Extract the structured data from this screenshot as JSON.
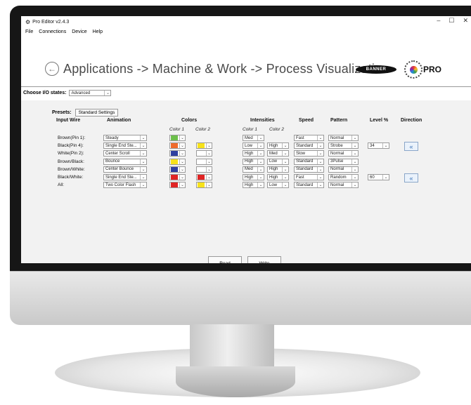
{
  "window": {
    "title": "Pro Editor v2.4.3",
    "controls": [
      "–",
      "☐",
      "✕"
    ]
  },
  "menu": [
    "File",
    "Connections",
    "Device",
    "Help"
  ],
  "breadcrumb": "Applications -> Machine & Work -> Process Visualization",
  "logos": {
    "banner": "BANNER",
    "pro": "PRO"
  },
  "io_states": {
    "label": "Choose I/O states:",
    "value": "Advanced"
  },
  "presets": {
    "label": "Presets:",
    "button": "Standard Settings"
  },
  "headers": {
    "input_wire": "Input Wire",
    "animation": "Animation",
    "colors": "Colors",
    "color1": "Color 1",
    "color2": "Color 2",
    "intensities": "Intensities",
    "int1": "Color 1",
    "int2": "Color 2",
    "speed": "Speed",
    "pattern": "Pattern",
    "level": "Level %",
    "direction": "Direction"
  },
  "rows": [
    {
      "wire": "Brown(Pin 1):",
      "animation": "Steady",
      "color1": "#6cbf4a",
      "color2": null,
      "int1": "Med",
      "int2": null,
      "speed": "Fast",
      "pattern": "Normal",
      "level": null,
      "direction": null
    },
    {
      "wire": "Black(Pin 4):",
      "animation": "Single End Ste...",
      "color1": "#ef6b2c",
      "color2": "#f7e21a",
      "int1": "Low",
      "int2": "High",
      "speed": "Standard",
      "pattern": "Strobe",
      "level": "34",
      "direction": "«"
    },
    {
      "wire": "White(Pin 2):",
      "animation": "Center Scroll",
      "color1": "#2f3fa0",
      "color2": "",
      "int1": "High",
      "int2": "Med",
      "speed": "Slow",
      "pattern": "Normal",
      "level": null,
      "direction": null
    },
    {
      "wire": "Brown/Black:",
      "animation": "Bounce",
      "color1": "#f7e21a",
      "color2": "",
      "int1": "High",
      "int2": "Low",
      "speed": "Standard",
      "pattern": "3Pulse",
      "level": null,
      "direction": null
    },
    {
      "wire": "Brown/White:",
      "animation": "Center Bounce",
      "color1": "#2f3fa0",
      "color2": "",
      "int1": "Med",
      "int2": "High",
      "speed": "Standard",
      "pattern": "Normal",
      "level": null,
      "direction": null
    },
    {
      "wire": "Black/White:",
      "animation": "Single End Ste...",
      "color1": "#e02424",
      "color2": "#e02424",
      "int1": "High",
      "int2": "High",
      "speed": "Fast",
      "pattern": "Random",
      "level": "60",
      "direction": "«"
    },
    {
      "wire": "All:",
      "animation": "Two Color Flash",
      "color1": "#e02424",
      "color2": "#f7e21a",
      "int1": "High",
      "int2": "Low",
      "speed": "Standard",
      "pattern": "Normal",
      "level": null,
      "direction": null
    }
  ],
  "buttons": {
    "read": "Read",
    "write": "Write"
  },
  "icons": {
    "dropdown": "chevron-down-icon",
    "back": "back-arrow-icon",
    "direction": "double-chevron-left-icon",
    "app": "gear-icon"
  }
}
